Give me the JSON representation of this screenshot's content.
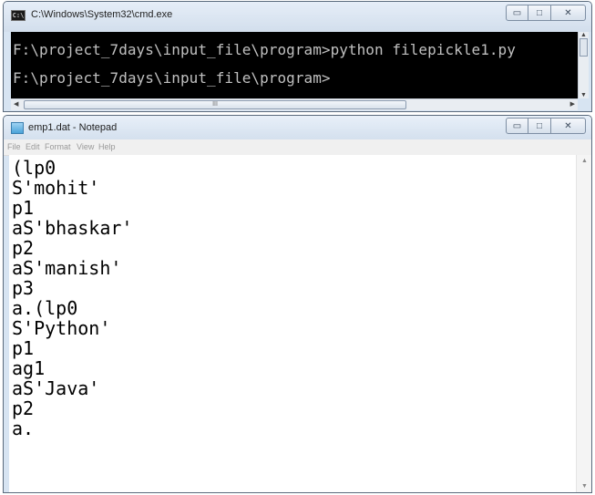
{
  "cmd": {
    "title": "C:\\Windows\\System32\\cmd.exe",
    "icon": "cmd-console-icon",
    "icon_glyph": "C:\\",
    "lines": [
      "F:\\project_7days\\input_file\\program>python filepickle1.py",
      "F:\\project_7days\\input_file\\program>"
    ],
    "scroll_grip": "III"
  },
  "notepad": {
    "title": "emp1.dat - Notepad",
    "icon": "notepad-icon",
    "menu": [
      "File",
      "Edit",
      "Format",
      "View",
      "Help"
    ],
    "lines": [
      "(lp0",
      "S'mohit'",
      "p1",
      "aS'bhaskar'",
      "p2",
      "aS'manish'",
      "p3",
      "a.(lp0",
      "S'Python'",
      "p1",
      "ag1",
      "aS'Java'",
      "p2",
      "a."
    ]
  },
  "window_controls": {
    "minimize": "▭",
    "maximize": "□",
    "close": "✕"
  },
  "colors": {
    "console_bg": "#000000",
    "console_text": "#c0c0c0",
    "frame": "#d7e4f2"
  }
}
